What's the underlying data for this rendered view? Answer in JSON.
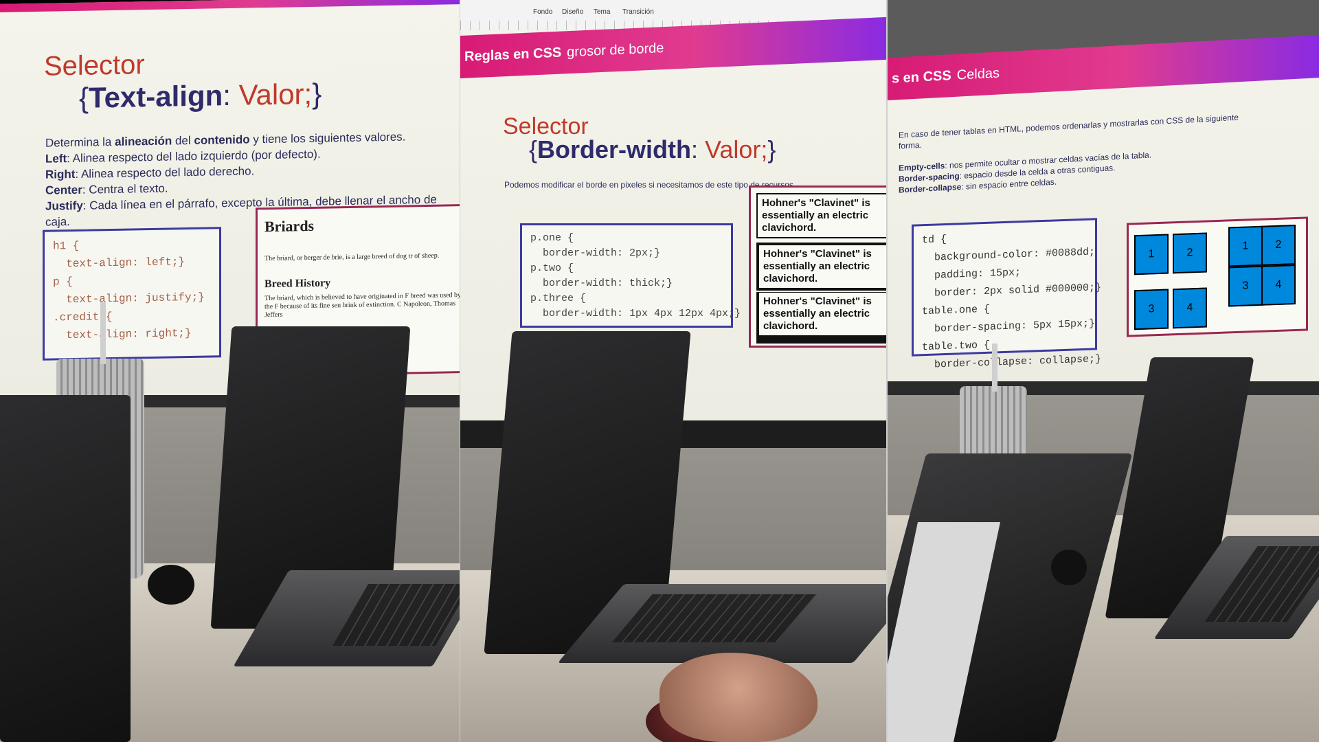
{
  "panel1": {
    "selector": "Selector",
    "rule_open": "{",
    "property": "Text-align",
    "colon": ":",
    "value": "Valor;",
    "rule_close": "}",
    "intro_pre": "Determina la ",
    "intro_b1": "alineación",
    "intro_mid": " del ",
    "intro_b2": "contenido",
    "intro_post": " y tiene los siguientes valores.",
    "left_key": "Left",
    "left_text": ": Alinea respecto del lado izquierdo (por defecto).",
    "right_key": "Right",
    "right_text": ": Alinea respecto del lado derecho.",
    "center_key": "Center",
    "center_text": ": Centra el texto.",
    "justify_key": "Justify",
    "justify_text": ": Cada línea en el párrafo, excepto la última, debe llenar el ancho de",
    "justify_cont": "caja.",
    "code": "h1 {\n  text-align: left;}\np {\n  text-align: justify;}\n.credit {\n  text-align: right;}",
    "briards_title": "Briards",
    "briards_text": "The briard, or berger de brie, is a large breed of dog tr of sheep.",
    "breed_history": "Breed History",
    "breed_text": "The briard, which is believed to have originated in F breed was used by the F because of its fine sen brink of extinction. C Napoleon, Thomas Jeffers"
  },
  "panel2": {
    "toolbar": [
      "Fondo",
      "Diseño",
      "Tema",
      "Transición"
    ],
    "banner_bold": "Reglas en CSS",
    "banner_sub": "grosor de borde",
    "selector": "Selector",
    "rule_open": "{",
    "property": "Border-width",
    "colon": ":",
    "value": "Valor;",
    "rule_close": "}",
    "intro": "Podemos modificar el borde en pixeles si necesitamos de este tipo de recursos.",
    "code": "p.one {\n  border-width: 2px;}\np.two {\n  border-width: thick;}\np.three {\n  border-width: 1px 4px 12px 4px;}",
    "hohner": [
      "Hohner's \"Clavinet\" is essentially an electric clavichord.",
      "Hohner's \"Clavinet\" is essentially an electric clavichord.",
      "Hohner's \"Clavinet\" is essentially an electric clavichord."
    ]
  },
  "panel3": {
    "banner_bold": "s en CSS",
    "banner_sub": "Celdas",
    "intro": "En caso de tener tablas en HTML, podemos ordenarlas y mostrarlas con CSS de la siguiente forma.",
    "empty_key": "Empty-cells",
    "empty_text": ": nos permite ocultar o mostrar celdas vacías de la tabla.",
    "spacing_key": "Border-spacing",
    "spacing_text": ": espacio desde la celda a otras contiguas.",
    "collapse_key": "Border-collapse",
    "collapse_text": ": sin espacio entre celdas.",
    "code": "td {\n  background-color: #0088dd;\n  padding: 15px;\n  border: 2px solid #000000;}\ntable.one {\n  border-spacing: 5px 15px;}\ntable.two {\n  border-collapse: collapse;}",
    "table_one_cells": [
      "1",
      "2",
      "3",
      "4"
    ],
    "table_two_cells": [
      "1",
      "2",
      "3",
      "4"
    ],
    "cell_color": "#0088dd"
  },
  "colors": {
    "banner_start": "#d81b75",
    "banner_end": "#8a2be2",
    "selector_red": "#c0392b",
    "heading_navy": "#2e2a6b",
    "code_border": "#3b3aa0",
    "box_border": "#9b2752"
  }
}
